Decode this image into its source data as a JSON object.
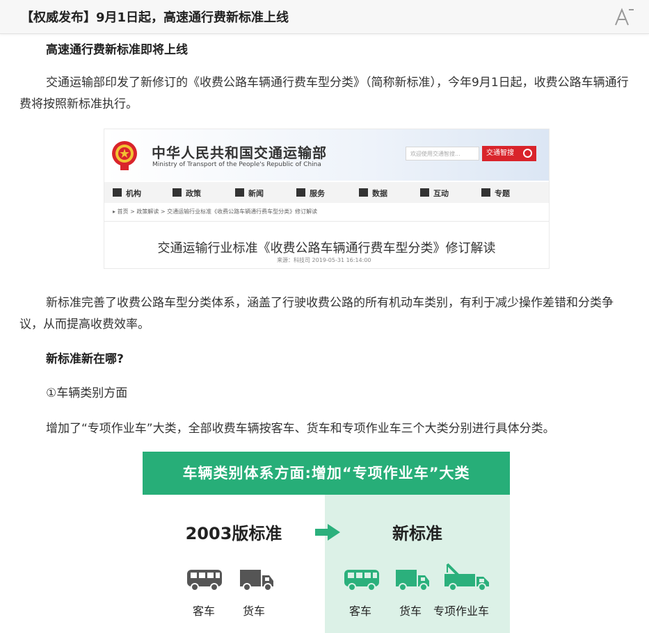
{
  "header": {
    "title": "【权威发布】9月1日起，高速通行费新标准上线",
    "font_icon": "font-size-icon"
  },
  "article": {
    "heading1": "高速通行费新标准即将上线",
    "para1": "交通运输部印发了新修订的《收费公路车辆通行费车型分类》（简称新标准），今年9月1日起，收费公路车辆通行费将按照新标准执行。",
    "para2": "新标准完善了收费公路车型分类体系，涵盖了行驶收费公路的所有机动车类别，有利于减少操作差错和分类争议，从而提高收费效率。",
    "heading2": "新标准新在哪?",
    "point1": "①车辆类别方面",
    "para3": "增加了“专项作业车”大类，全部收费车辆按客车、货车和专项作业车三个大类分别进行具体分类。"
  },
  "ministry_page": {
    "name_cn": "中华人民共和国交通运输部",
    "name_en": "Ministry of Transport of the People's Republic of China",
    "search_placeholder": "欢迎使用交通智搜...",
    "search_button": "交通智搜",
    "nav": [
      "机构",
      "政策",
      "新闻",
      "服务",
      "数据",
      "互动",
      "专题"
    ],
    "breadcrumb": "▸ 首页 > 政策解读 > 交通运输行业标准《收费公路车辆通行费车型分类》修订解读",
    "doc_title": "交通运输行业标准《收费公路车辆通行费车型分类》修订解读",
    "doc_meta": "来源：科技司      2019-05-31 16:14:00"
  },
  "infographic": {
    "banner": "车辆类别体系方面:增加“专项作业车”大类",
    "old_title": "2003版标准",
    "new_title": "新标准",
    "old_labels": [
      "客车",
      "货车"
    ],
    "new_labels": [
      "客车",
      "货车",
      "专项作业车"
    ],
    "colors": {
      "banner": "#27ae78",
      "right_bg": "#dcf1e7",
      "old_icon": "#555555",
      "new_icon": "#2bb07c"
    }
  }
}
